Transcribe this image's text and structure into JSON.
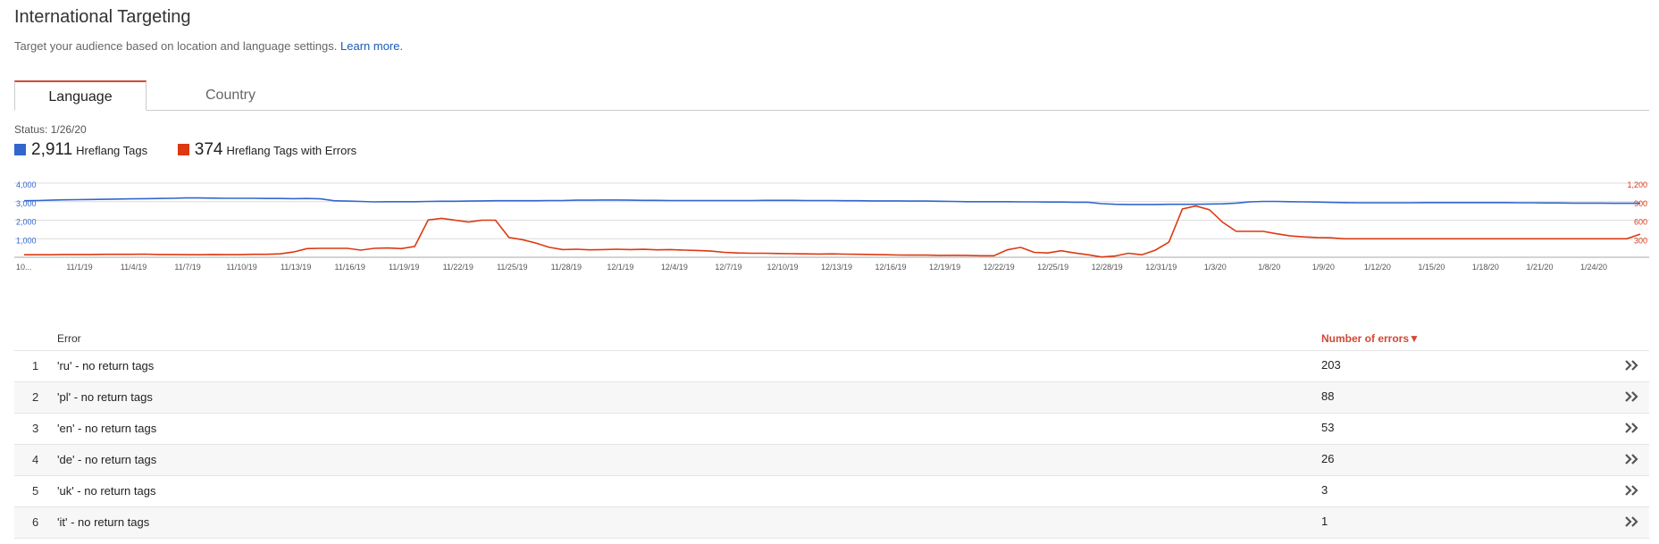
{
  "header": {
    "title": "International Targeting",
    "subtitle": "Target your audience based on location and language settings.",
    "learn_more": "Learn more."
  },
  "tabs": [
    {
      "label": "Language",
      "active": true
    },
    {
      "label": "Country",
      "active": false
    }
  ],
  "status": "Status: 1/26/20",
  "legend": [
    {
      "value": "2,911",
      "label": "Hreflang Tags",
      "color": "#3366cc"
    },
    {
      "value": "374",
      "label": "Hreflang Tags with Errors",
      "color": "#dc3912"
    }
  ],
  "chart_data": {
    "type": "line",
    "x_tick_labels": [
      "10...",
      "11/1/19",
      "11/4/19",
      "11/7/19",
      "11/10/19",
      "11/13/19",
      "11/16/19",
      "11/19/19",
      "11/22/19",
      "11/25/19",
      "11/28/19",
      "12/1/19",
      "12/4/19",
      "12/7/19",
      "12/10/19",
      "12/13/19",
      "12/16/19",
      "12/19/19",
      "12/22/19",
      "12/25/19",
      "12/28/19",
      "12/31/19",
      "1/3/20",
      "1/8/20",
      "1/9/20",
      "1/12/20",
      "1/15/20",
      "1/18/20",
      "1/21/20",
      "1/24/20"
    ],
    "y_left_ticks": [
      "4,000",
      "3,000",
      "2,000",
      "1,000"
    ],
    "y_right_ticks": [
      "1,200",
      "900",
      "600",
      "300"
    ],
    "y_left_range": [
      0,
      4000
    ],
    "y_right_range": [
      0,
      1200
    ],
    "grid": true,
    "series": [
      {
        "name": "Hreflang Tags",
        "axis": "left",
        "color": "#3366cc",
        "values": [
          3050,
          3060,
          3080,
          3100,
          3110,
          3120,
          3130,
          3140,
          3150,
          3160,
          3170,
          3180,
          3200,
          3200,
          3190,
          3180,
          3180,
          3180,
          3170,
          3170,
          3160,
          3170,
          3150,
          3050,
          3030,
          3010,
          2990,
          3000,
          3000,
          3000,
          3010,
          3020,
          3020,
          3030,
          3040,
          3050,
          3050,
          3050,
          3050,
          3060,
          3060,
          3080,
          3080,
          3090,
          3090,
          3080,
          3070,
          3070,
          3060,
          3060,
          3060,
          3060,
          3060,
          3060,
          3060,
          3070,
          3070,
          3070,
          3060,
          3060,
          3060,
          3050,
          3050,
          3040,
          3040,
          3040,
          3030,
          3030,
          3020,
          3010,
          3000,
          3000,
          3000,
          3000,
          2990,
          2990,
          2980,
          2980,
          2970,
          2970,
          2890,
          2860,
          2850,
          2850,
          2850,
          2860,
          2860,
          2860,
          2870,
          2880,
          2920,
          2990,
          3010,
          3010,
          3000,
          2990,
          2980,
          2960,
          2950,
          2940,
          2940,
          2940,
          2940,
          2940,
          2950,
          2950,
          2950,
          2950,
          2950,
          2950,
          2950,
          2940,
          2940,
          2930,
          2930,
          2920,
          2920,
          2920,
          2910,
          2910,
          2911
        ]
      },
      {
        "name": "Hreflang Tags with Errors",
        "axis": "right",
        "color": "#dc3912",
        "values": [
          40,
          40,
          40,
          45,
          45,
          45,
          48,
          48,
          48,
          50,
          45,
          45,
          42,
          40,
          45,
          42,
          42,
          48,
          48,
          55,
          85,
          140,
          145,
          145,
          145,
          115,
          145,
          150,
          140,
          175,
          605,
          630,
          600,
          570,
          600,
          600,
          320,
          285,
          230,
          160,
          125,
          130,
          120,
          125,
          130,
          125,
          128,
          120,
          125,
          115,
          110,
          100,
          80,
          70,
          65,
          65,
          60,
          58,
          55,
          52,
          55,
          50,
          48,
          45,
          40,
          36,
          35,
          35,
          30,
          32,
          30,
          25,
          25,
          120,
          160,
          80,
          70,
          105,
          70,
          40,
          5,
          20,
          65,
          40,
          115,
          245,
          780,
          830,
          770,
          565,
          420,
          420,
          420,
          380,
          345,
          330,
          320,
          315,
          300,
          300,
          300,
          300,
          300,
          300,
          300,
          300,
          300,
          300,
          300,
          300,
          300,
          300,
          300,
          300,
          300,
          300,
          300,
          300,
          300,
          300,
          374
        ]
      }
    ]
  },
  "table": {
    "columns": [
      "Error",
      "Number of errors▼"
    ],
    "rows": [
      {
        "index": "1",
        "error": "'ru' - no return tags",
        "count": "203"
      },
      {
        "index": "2",
        "error": "'pl' - no return tags",
        "count": "88"
      },
      {
        "index": "3",
        "error": "'en' - no return tags",
        "count": "53"
      },
      {
        "index": "4",
        "error": "'de' - no return tags",
        "count": "26"
      },
      {
        "index": "5",
        "error": "'uk' - no return tags",
        "count": "3"
      },
      {
        "index": "6",
        "error": "'it' - no return tags",
        "count": "1"
      }
    ]
  }
}
